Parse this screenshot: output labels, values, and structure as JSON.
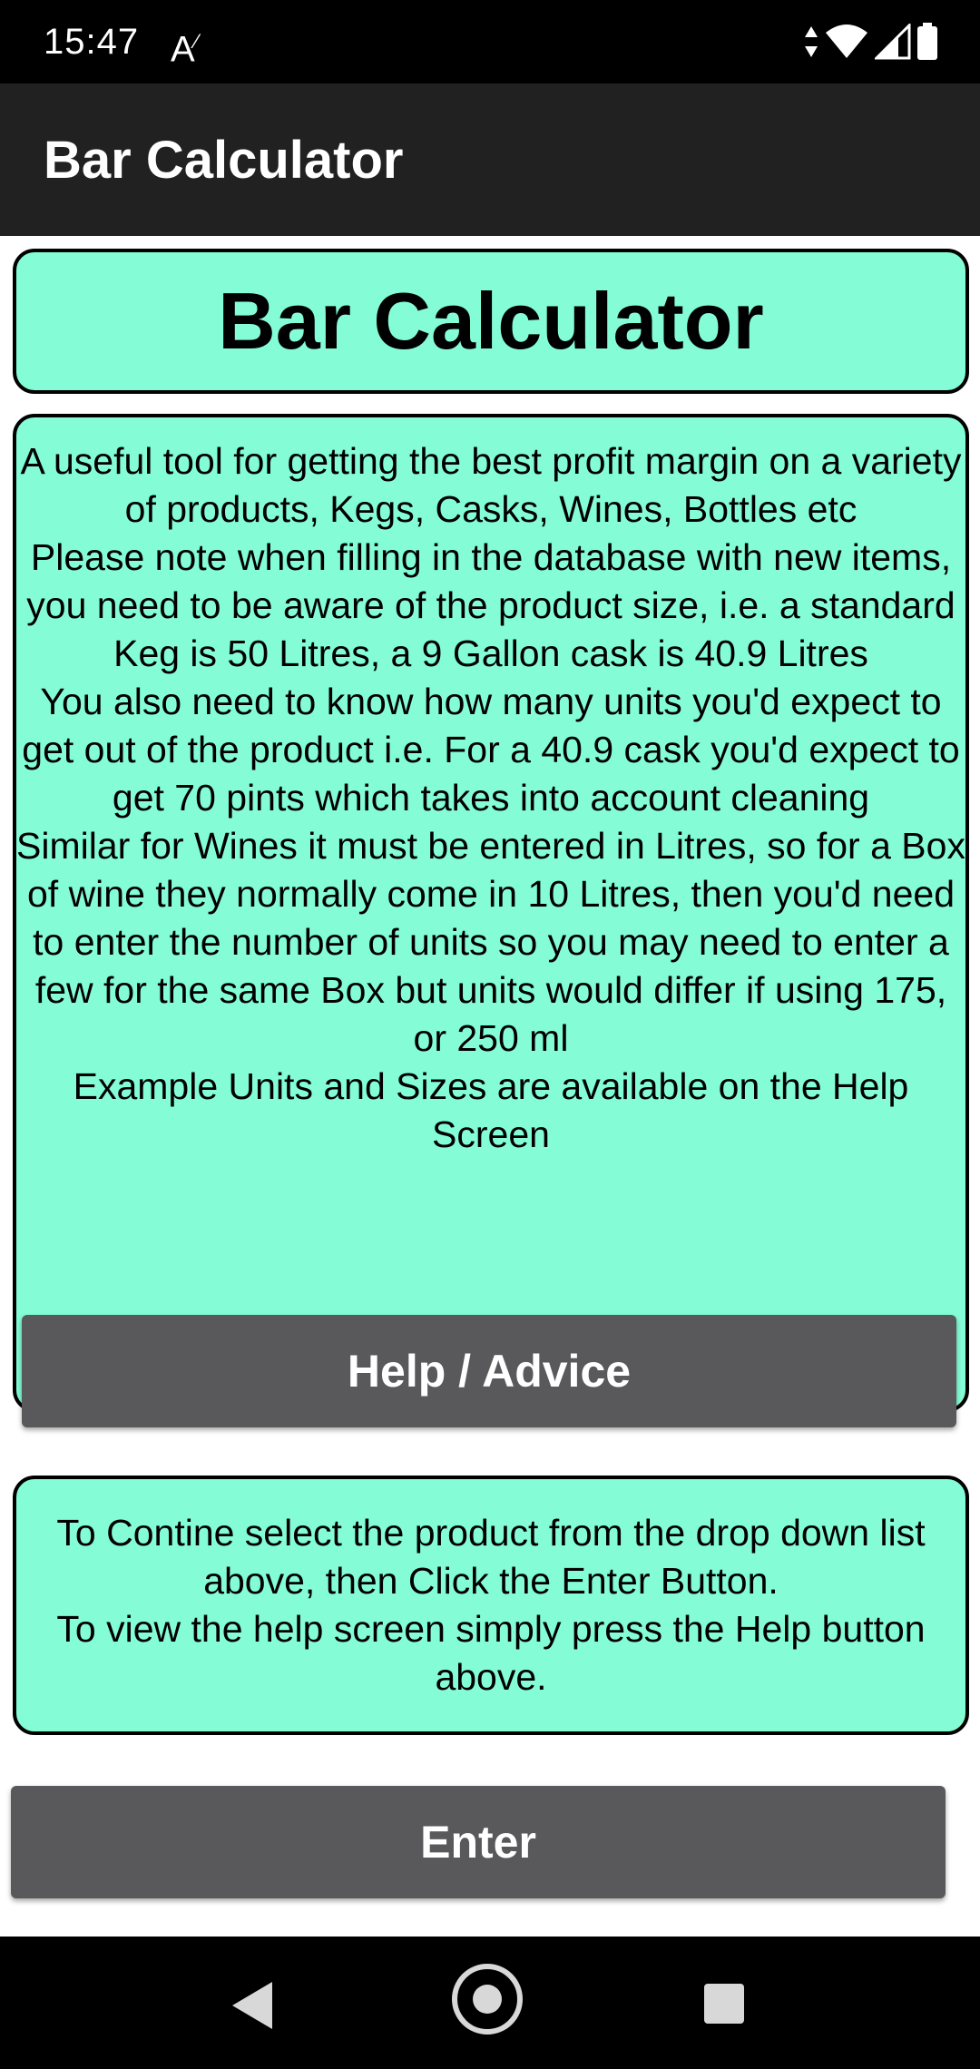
{
  "status_bar": {
    "time": "15:47",
    "notification_icon": "A",
    "icons": [
      "data-arrows-icon",
      "wifi-icon",
      "signal-icon",
      "battery-icon"
    ]
  },
  "app_bar": {
    "title": "Bar Calculator"
  },
  "main": {
    "heading": "Bar Calculator",
    "description": "A useful tool for getting the best profit margin on a variety of products, Kegs, Casks, Wines, Bottles etc\nPlease note when filling in the database with new items, you need to be aware of the product size, i.e. a standard Keg is 50 Litres, a 9 Gallon cask is 40.9 Litres\nYou also need to know how many units you'd expect to get out of the product i.e. For a 40.9 cask you'd expect to get 70 pints which takes into account cleaning\nSimilar for Wines it must be entered in Litres, so for a Box of  wine they normally come in 10 Litres, then you'd need to enter the number of units so you may need to enter a few for the same Box but units would differ if using 175, or 250 ml\nExample Units and Sizes are available on the Help Screen",
    "help_button_label": "Help / Advice",
    "instructions": "To Contine select the product from the drop down list above, then Click the Enter Button.\nTo view the help screen simply press the Help button above.",
    "enter_button_label": "Enter"
  },
  "nav_bar": {
    "icons": [
      "back-icon",
      "home-icon",
      "recents-icon"
    ]
  },
  "colors": {
    "panel_background": "#84fdd7",
    "button_background": "#59595b",
    "app_bar_background": "#212121"
  }
}
